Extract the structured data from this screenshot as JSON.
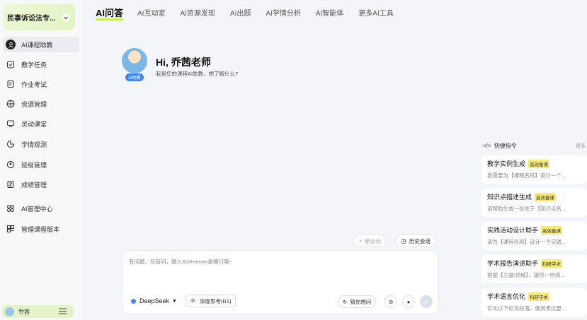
{
  "sidebar": {
    "course_name": "民事诉讼法专...",
    "items": [
      {
        "label": "AI课程助教",
        "icon": "ai-assistant-icon"
      },
      {
        "label": "教学任务",
        "icon": "task-icon"
      },
      {
        "label": "作业考试",
        "icon": "exam-icon"
      },
      {
        "label": "资源管理",
        "icon": "resource-icon"
      },
      {
        "label": "灵动课堂",
        "icon": "classroom-icon"
      },
      {
        "label": "学情观测",
        "icon": "observation-icon"
      },
      {
        "label": "班级管理",
        "icon": "class-icon"
      },
      {
        "label": "成绩管理",
        "icon": "grade-icon"
      },
      {
        "label": "AI管理中心",
        "icon": "ai-center-icon"
      },
      {
        "label": "管理课程版本",
        "icon": "version-icon"
      }
    ],
    "user_name": "乔茜"
  },
  "topnav": {
    "tabs": [
      "AI问答",
      "AI互动室",
      "AI资源发现",
      "AI出题",
      "AI学情分析",
      "AI智能体",
      "更多AI工具"
    ]
  },
  "greeting": {
    "ai_tag": "AI助教",
    "title": "Hi, 乔茜老师",
    "subtitle": "我是您的课程AI助教，想了解什么?"
  },
  "session": {
    "new_label": "新会话",
    "history_label": "历史会话"
  },
  "input": {
    "placeholder": "有问题，尽管问，输入Shift+enter是换行哦~",
    "model": "DeepSeek",
    "deep_think": "深度思考(R1)",
    "guess": "猜你想问"
  },
  "quick": {
    "title": "快捷指令",
    "more": "更多",
    "cards": [
      {
        "title": "教学实例生成",
        "tag": "高效备课",
        "desc": "我需要为【课程名称】设计一个..."
      },
      {
        "title": "知识点描述生成",
        "tag": "高效备课",
        "desc": "请帮助生成一份关于【知识点名..."
      },
      {
        "title": "实践活动设计助手",
        "tag": "高效备课",
        "desc": "请为【课程名称】设计一个实践..."
      },
      {
        "title": "学术报告演讲助手",
        "tag": "科研学术",
        "desc": "根据【主题/领域】，提供一份清..."
      },
      {
        "title": "学术语言优化",
        "tag": "科研学术",
        "desc": "优化以下论文段落，使其表达更..."
      }
    ]
  },
  "colors": {
    "accent": "#c8f04a",
    "tag_bg": "#f7ea7a",
    "model_dot": "#3d8bff"
  }
}
